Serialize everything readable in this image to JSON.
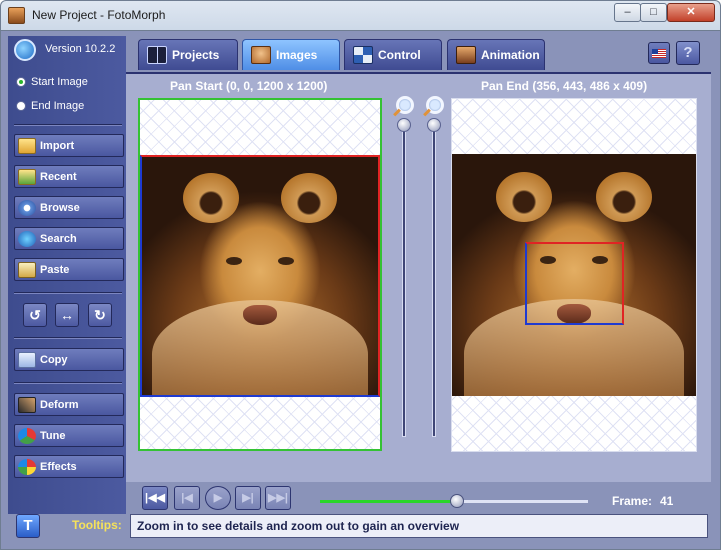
{
  "window": {
    "title": "New Project - FotoMorph",
    "minimize_glyph": "–",
    "maximize_glyph": "□",
    "close_glyph": "✕"
  },
  "app": {
    "version": "Version 10.2.2"
  },
  "image_selector": {
    "start": "Start Image",
    "end": "End Image",
    "selected": "start"
  },
  "sidebar": {
    "import": "Import",
    "recent": "Recent",
    "browse": "Browse",
    "search": "Search",
    "paste": "Paste",
    "rotate_left": "↺",
    "flip": "↔",
    "rotate_right": "↻",
    "copy": "Copy",
    "deform": "Deform",
    "tune": "Tune",
    "effects": "Effects"
  },
  "tabs": [
    {
      "label": "Projects",
      "active": false
    },
    {
      "label": "Images",
      "active": true
    },
    {
      "label": "Control",
      "active": false
    },
    {
      "label": "Animation",
      "active": false
    }
  ],
  "help_glyph": "?",
  "pan": {
    "start_label": "Pan Start (0, 0, 1200 x 1200)",
    "end_label": "Pan End (356, 443, 486 x 409)"
  },
  "playback": {
    "first": "|◀◀",
    "prev": "|◀",
    "play": "▶",
    "next": "▶|",
    "last": "▶▶|",
    "progress": 0.51,
    "frame_label": "Frame:",
    "frame_value": "41"
  },
  "status": {
    "t_glyph": "T",
    "tooltips_label": "Tooltips:",
    "tooltips_text": "Zoom in to see details and zoom out to gain an overview"
  },
  "colors": {
    "panel_bg": "#8a93b9",
    "active_tab": "#4f8ee6",
    "start_frame_border": "#34c234",
    "selection_red": "#e02424",
    "selection_blue": "#1e3ad1",
    "tooltips_label": "#f6e25a"
  }
}
